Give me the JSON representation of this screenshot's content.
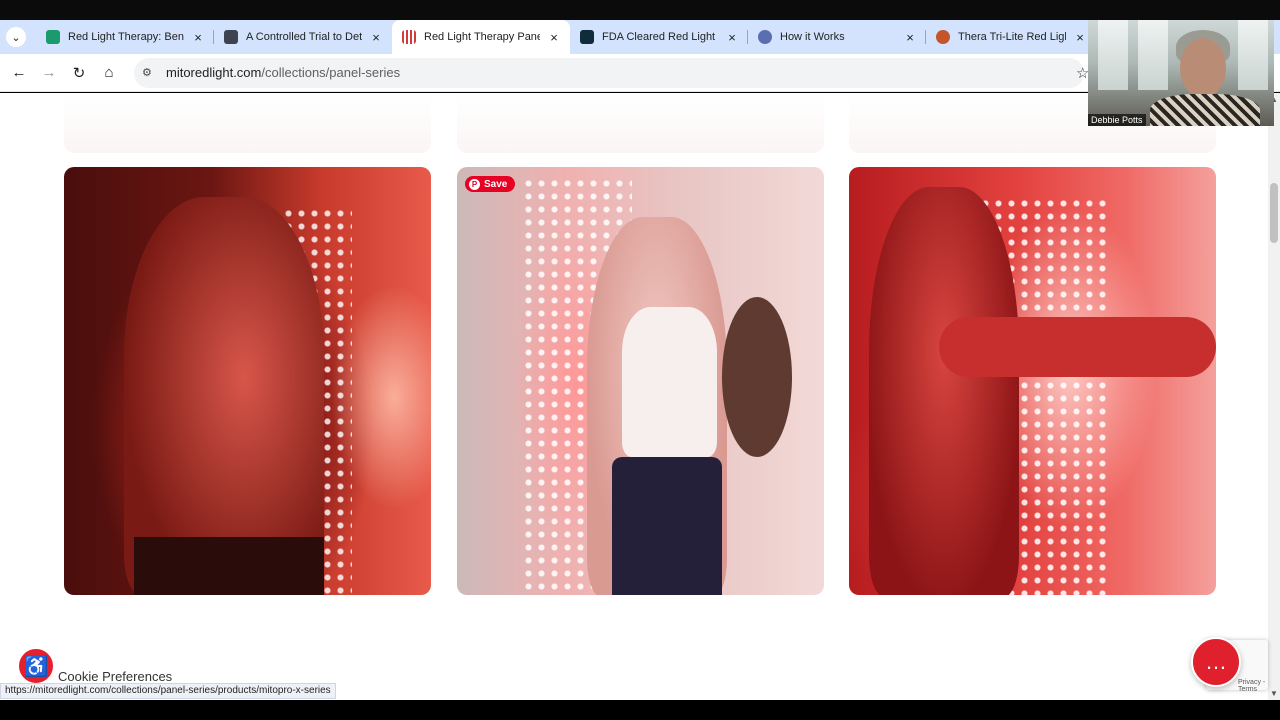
{
  "browser": {
    "tabs": [
      {
        "title": "Red Light Therapy: Benefit",
        "favicon_color": "#1a9b6e",
        "active": false
      },
      {
        "title": "A Controlled Trial to Deter",
        "favicon_color": "#3c4250",
        "active": false
      },
      {
        "title": "Red Light Therapy Panels |",
        "favicon_color": "#d23a3a",
        "active": true
      },
      {
        "title": "FDA Cleared Red Light The",
        "favicon_color": "#0e2c3a",
        "active": false
      },
      {
        "title": "How it Works",
        "favicon_color": "#5b6fb0",
        "active": false
      },
      {
        "title": "Thera Tri-Lite Red Light Th",
        "favicon_color": "#c4552a",
        "active": false
      }
    ],
    "close_glyph": "×",
    "url_host": "mitoredlight.com",
    "url_path": "/collections/panel-series",
    "status_url": "https://mitoredlight.com/collections/panel-series/products/mitopro-x-series"
  },
  "page": {
    "save_label": "Save",
    "cookie_label": "Cookie Preferences",
    "recaptcha_terms": "Privacy - Terms"
  },
  "webcam": {
    "name": "Debbie Potts"
  },
  "colors": {
    "brand_red": "#e0202c",
    "pinterest_red": "#e60023",
    "tabstrip": "#d3e3fd"
  }
}
